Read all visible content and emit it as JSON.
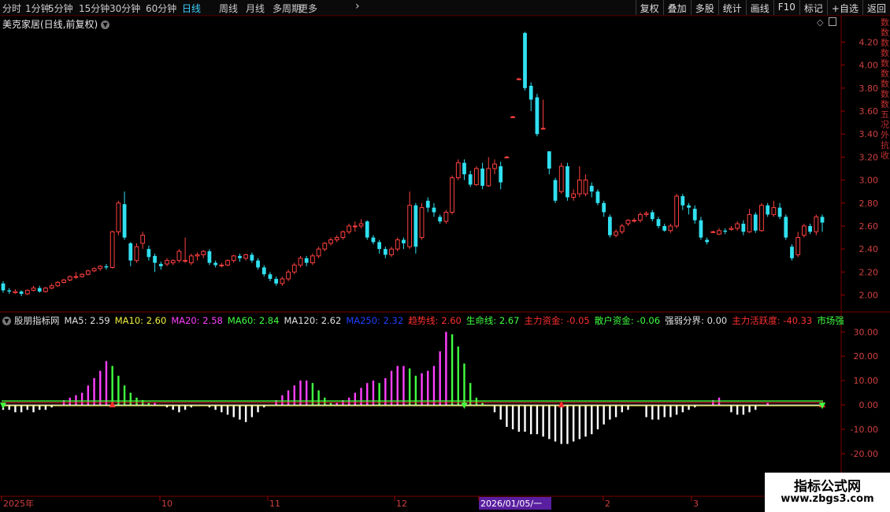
{
  "periods": [
    {
      "label": "分时",
      "active": false
    },
    {
      "label": "1分钟",
      "active": false
    },
    {
      "label": "5分钟",
      "active": false
    },
    {
      "label": "15分钟",
      "active": false
    },
    {
      "label": "30分钟",
      "active": false
    },
    {
      "label": "60分钟",
      "active": false
    },
    {
      "label": "日线",
      "active": true
    },
    {
      "label": "周线",
      "active": false
    },
    {
      "label": "月线",
      "active": false
    },
    {
      "label": "多周期",
      "active": false
    },
    {
      "label": "更多",
      "active": false
    }
  ],
  "toolbar": [
    "复权",
    "叠加",
    "多股",
    "统计",
    "画线",
    "F10",
    "标记",
    "+自选",
    "返回"
  ],
  "stock_title": "美克家居(日线,前复权)",
  "indicator_legend": [
    {
      "text": "股朋指标网",
      "color": "#e0e0e0"
    },
    {
      "text": "MA5: 2.59",
      "color": "#e0e0e0"
    },
    {
      "text": "MA10: 2.60",
      "color": "#f0f040"
    },
    {
      "text": "MA20: 2.58",
      "color": "#ff40ff"
    },
    {
      "text": "MA60: 2.84",
      "color": "#40ff40"
    },
    {
      "text": "MA120: 2.62",
      "color": "#e0e0e0"
    },
    {
      "text": "MA250: 2.32",
      "color": "#2040ff"
    },
    {
      "text": "趋势线: 2.60",
      "color": "#ff3030"
    },
    {
      "text": "生命线: 2.67",
      "color": "#40ff40"
    },
    {
      "text": "主力资金: -0.05",
      "color": "#ff3030"
    },
    {
      "text": "散户资金: -0.06",
      "color": "#40ff40"
    },
    {
      "text": "强弱分界: 0.00",
      "color": "#e0e0e0"
    },
    {
      "text": "主力活跃度: -40.33",
      "color": "#ff3030"
    },
    {
      "text": "市场强弱: -40.33",
      "color": "#40ff40"
    }
  ],
  "right_strip": [
    "数",
    "数",
    "数",
    "数",
    "数",
    "数",
    "数",
    "数",
    "数",
    "五",
    "况",
    "外",
    "抗",
    "收"
  ],
  "price_axis": [
    "4.20",
    "4.00",
    "3.80",
    "3.60",
    "3.40",
    "3.20",
    "3.00",
    "2.80",
    "2.60",
    "2.40",
    "2.20",
    "2.00"
  ],
  "osc_axis": [
    "30.00",
    "20.00",
    "10.00",
    "0.00",
    "-10.00",
    "-20.00",
    "-30.00"
  ],
  "time_axis": [
    {
      "label": "2025年",
      "highlight": false
    },
    {
      "label": "10",
      "highlight": false
    },
    {
      "label": "11",
      "highlight": false
    },
    {
      "label": "12",
      "highlight": false
    },
    {
      "label": "2026/01/05/一",
      "highlight": true
    },
    {
      "label": "2",
      "highlight": false
    },
    {
      "label": "3",
      "highlight": false
    }
  ],
  "watermark": {
    "line1": "指标公式网",
    "line2": "www.zbgs3.com"
  },
  "colors": {
    "up": "#ff4040",
    "down": "#30e0f0",
    "osc_pos_up": "#ff40ff",
    "osc_pos_down": "#40ff40",
    "osc_neg": "#ffffff"
  },
  "chart_data": [
    {
      "type": "candlestick",
      "title": "美克家居(日线,前复权)",
      "ylim": [
        1.88,
        4.32
      ],
      "candles": [
        [
          2.1,
          2.04,
          2.12,
          2.02
        ],
        [
          2.04,
          2.03,
          2.06,
          2.01
        ],
        [
          2.02,
          2.03,
          2.05,
          2.01
        ],
        [
          2.03,
          2.01,
          2.04,
          1.99
        ],
        [
          2.01,
          2.04,
          2.05,
          2.0
        ],
        [
          2.04,
          2.06,
          2.08,
          2.03
        ],
        [
          2.06,
          2.03,
          2.08,
          2.02
        ],
        [
          2.03,
          2.06,
          2.07,
          2.02
        ],
        [
          2.06,
          2.08,
          2.1,
          2.05
        ],
        [
          2.08,
          2.11,
          2.12,
          2.07
        ],
        [
          2.11,
          2.13,
          2.14,
          2.1
        ],
        [
          2.13,
          2.16,
          2.17,
          2.12
        ],
        [
          2.16,
          2.16,
          2.2,
          2.14
        ],
        [
          2.16,
          2.18,
          2.19,
          2.15
        ],
        [
          2.18,
          2.21,
          2.22,
          2.17
        ],
        [
          2.21,
          2.23,
          2.24,
          2.2
        ],
        [
          2.23,
          2.25,
          2.26,
          2.21
        ],
        [
          2.25,
          2.24,
          2.27,
          2.22
        ],
        [
          2.24,
          2.55,
          2.56,
          2.23
        ],
        [
          2.55,
          2.8,
          2.82,
          2.52
        ],
        [
          2.79,
          2.5,
          2.9,
          2.48
        ],
        [
          2.45,
          2.3,
          2.46,
          2.25
        ],
        [
          2.3,
          2.42,
          2.45,
          2.28
        ],
        [
          2.45,
          2.52,
          2.55,
          2.4
        ],
        [
          2.4,
          2.33,
          2.43,
          2.3
        ],
        [
          2.34,
          2.28,
          2.36,
          2.2
        ],
        [
          2.27,
          2.25,
          2.29,
          2.22
        ],
        [
          2.27,
          2.3,
          2.32,
          2.25
        ],
        [
          2.28,
          2.3,
          2.31,
          2.26
        ],
        [
          2.3,
          2.38,
          2.4,
          2.28
        ],
        [
          2.3,
          2.3,
          2.5,
          2.28
        ],
        [
          2.28,
          2.34,
          2.36,
          2.26
        ],
        [
          2.34,
          2.35,
          2.37,
          2.3
        ],
        [
          2.35,
          2.38,
          2.39,
          2.32
        ],
        [
          2.38,
          2.28,
          2.4,
          2.26
        ],
        [
          2.28,
          2.26,
          2.3,
          2.24
        ],
        [
          2.26,
          2.26,
          2.28,
          2.24
        ],
        [
          2.26,
          2.3,
          2.31,
          2.25
        ],
        [
          2.3,
          2.34,
          2.35,
          2.28
        ],
        [
          2.34,
          2.32,
          2.36,
          2.29
        ],
        [
          2.32,
          2.35,
          2.36,
          2.3
        ],
        [
          2.35,
          2.3,
          2.37,
          2.28
        ],
        [
          2.3,
          2.24,
          2.32,
          2.22
        ],
        [
          2.24,
          2.18,
          2.26,
          2.16
        ],
        [
          2.18,
          2.14,
          2.2,
          2.12
        ],
        [
          2.14,
          2.1,
          2.16,
          2.08
        ],
        [
          2.1,
          2.14,
          2.16,
          2.08
        ],
        [
          2.14,
          2.2,
          2.22,
          2.12
        ],
        [
          2.2,
          2.26,
          2.28,
          2.18
        ],
        [
          2.26,
          2.32,
          2.34,
          2.24
        ],
        [
          2.32,
          2.28,
          2.34,
          2.25
        ],
        [
          2.28,
          2.34,
          2.36,
          2.26
        ],
        [
          2.34,
          2.4,
          2.42,
          2.32
        ],
        [
          2.4,
          2.45,
          2.46,
          2.38
        ],
        [
          2.45,
          2.48,
          2.5,
          2.43
        ],
        [
          2.48,
          2.5,
          2.52,
          2.46
        ],
        [
          2.5,
          2.55,
          2.56,
          2.48
        ],
        [
          2.55,
          2.6,
          2.62,
          2.53
        ],
        [
          2.6,
          2.6,
          2.64,
          2.55
        ],
        [
          2.6,
          2.62,
          2.66,
          2.58
        ],
        [
          2.64,
          2.5,
          2.65,
          2.48
        ],
        [
          2.5,
          2.46,
          2.52,
          2.44
        ],
        [
          2.46,
          2.4,
          2.48,
          2.36
        ],
        [
          2.4,
          2.35,
          2.42,
          2.32
        ],
        [
          2.35,
          2.4,
          2.42,
          2.33
        ],
        [
          2.4,
          2.48,
          2.5,
          2.38
        ],
        [
          2.48,
          2.45,
          2.5,
          2.4
        ],
        [
          2.42,
          2.78,
          2.9,
          2.4
        ],
        [
          2.78,
          2.42,
          2.8,
          2.36
        ],
        [
          2.5,
          2.76,
          2.8,
          2.48
        ],
        [
          2.82,
          2.76,
          2.85,
          2.72
        ],
        [
          2.76,
          2.72,
          2.8,
          2.68
        ],
        [
          2.68,
          2.64,
          2.7,
          2.62
        ],
        [
          2.64,
          2.72,
          2.74,
          2.62
        ],
        [
          2.72,
          3.02,
          3.04,
          2.7
        ],
        [
          3.02,
          3.15,
          3.18,
          3.0
        ],
        [
          3.15,
          3.05,
          3.18,
          3.0
        ],
        [
          3.05,
          2.96,
          3.08,
          2.94
        ],
        [
          2.96,
          3.1,
          3.12,
          2.95
        ],
        [
          3.1,
          2.95,
          3.15,
          2.92
        ],
        [
          2.95,
          3.1,
          3.2,
          2.94
        ],
        [
          3.1,
          3.14,
          3.18,
          3.05
        ],
        [
          3.12,
          2.98,
          3.16,
          2.92
        ],
        [
          3.2,
          3.2,
          3.21,
          3.19
        ],
        [
          3.55,
          3.55,
          3.56,
          3.54
        ],
        [
          3.88,
          3.88,
          3.89,
          3.87
        ],
        [
          4.28,
          3.8,
          4.29,
          3.78
        ],
        [
          3.82,
          3.7,
          3.85,
          3.6
        ],
        [
          3.72,
          3.4,
          3.75,
          3.38
        ],
        [
          3.45,
          3.45,
          3.7,
          3.44
        ],
        [
          3.25,
          3.1,
          3.25,
          3.05
        ],
        [
          3.0,
          2.82,
          3.02,
          2.8
        ],
        [
          2.9,
          3.12,
          3.15,
          2.88
        ],
        [
          3.12,
          2.85,
          3.15,
          2.82
        ],
        [
          2.85,
          2.88,
          2.92,
          2.82
        ],
        [
          2.88,
          3.0,
          3.12,
          2.85
        ],
        [
          2.88,
          3.0,
          3.05,
          2.86
        ],
        [
          2.95,
          2.9,
          2.98,
          2.85
        ],
        [
          2.9,
          2.8,
          2.92,
          2.78
        ],
        [
          2.8,
          2.72,
          2.82,
          2.68
        ],
        [
          2.68,
          2.52,
          2.7,
          2.5
        ],
        [
          2.52,
          2.55,
          2.57,
          2.5
        ],
        [
          2.55,
          2.6,
          2.62,
          2.53
        ],
        [
          2.62,
          2.65,
          2.66,
          2.6
        ],
        [
          2.65,
          2.65,
          2.67,
          2.63
        ],
        [
          2.65,
          2.7,
          2.72,
          2.63
        ],
        [
          2.7,
          2.71,
          2.73,
          2.68
        ],
        [
          2.72,
          2.66,
          2.74,
          2.64
        ],
        [
          2.66,
          2.6,
          2.68,
          2.58
        ],
        [
          2.6,
          2.56,
          2.62,
          2.55
        ],
        [
          2.56,
          2.6,
          2.62,
          2.54
        ],
        [
          2.6,
          2.86,
          2.88,
          2.58
        ],
        [
          2.86,
          2.78,
          2.88,
          2.74
        ],
        [
          2.78,
          2.76,
          2.8,
          2.7
        ],
        [
          2.75,
          2.65,
          2.78,
          2.62
        ],
        [
          2.65,
          2.5,
          2.68,
          2.48
        ],
        [
          2.48,
          2.46,
          2.5,
          2.44
        ],
        [
          2.55,
          2.55,
          2.56,
          2.54
        ],
        [
          2.53,
          2.56,
          2.58,
          2.52
        ],
        [
          2.56,
          2.55,
          2.58,
          2.53
        ],
        [
          2.57,
          2.58,
          2.6,
          2.56
        ],
        [
          2.58,
          2.62,
          2.64,
          2.56
        ],
        [
          2.62,
          2.55,
          2.65,
          2.52
        ],
        [
          2.55,
          2.7,
          2.75,
          2.54
        ],
        [
          2.7,
          2.56,
          2.72,
          2.54
        ],
        [
          2.56,
          2.78,
          2.8,
          2.55
        ],
        [
          2.78,
          2.7,
          2.8,
          2.68
        ],
        [
          2.7,
          2.76,
          2.82,
          2.68
        ],
        [
          2.76,
          2.68,
          2.8,
          2.66
        ],
        [
          2.68,
          2.5,
          2.7,
          2.48
        ],
        [
          2.42,
          2.32,
          2.44,
          2.3
        ],
        [
          2.35,
          2.5,
          2.55,
          2.33
        ],
        [
          2.52,
          2.6,
          2.62,
          2.5
        ],
        [
          2.6,
          2.55,
          2.62,
          2.53
        ],
        [
          2.55,
          2.68,
          2.7,
          2.52
        ],
        [
          2.68,
          2.63,
          2.7,
          2.55
        ]
      ]
    },
    {
      "type": "bar",
      "title": "股朋指标网",
      "ylim": [
        -31,
        33
      ],
      "values": [
        -2,
        -2,
        -3,
        -3,
        -2,
        -3,
        -2,
        -2,
        -1,
        0,
        2,
        3,
        4,
        5,
        8,
        11,
        14,
        18,
        16,
        12,
        8,
        5,
        3,
        2,
        1,
        1,
        0,
        -1,
        -2,
        -3,
        -2,
        -1,
        0,
        0,
        -1,
        -2,
        -3,
        -4,
        -5,
        -6,
        -7,
        -5,
        -3,
        -1,
        0,
        2,
        4,
        6,
        8,
        10,
        10,
        9,
        6,
        3,
        1,
        1,
        2,
        3,
        5,
        7,
        9,
        10,
        9,
        11,
        14,
        16,
        16,
        15,
        12,
        13,
        14,
        16,
        22,
        30,
        29,
        24,
        17,
        9,
        3,
        1,
        0,
        -3,
        -6,
        -9,
        -10,
        -11,
        -11,
        -12,
        -12,
        -13,
        -14,
        -15,
        -16,
        -16,
        -15,
        -14,
        -13,
        -12,
        -10,
        -8,
        -6,
        -5,
        -3,
        -2,
        0,
        0,
        -5,
        -6,
        -6,
        -5,
        -5,
        -4,
        -3,
        -2,
        -1,
        0,
        0,
        2,
        3,
        0,
        -3,
        -4,
        -4,
        -3,
        -2,
        0,
        1,
        0
      ]
    }
  ]
}
